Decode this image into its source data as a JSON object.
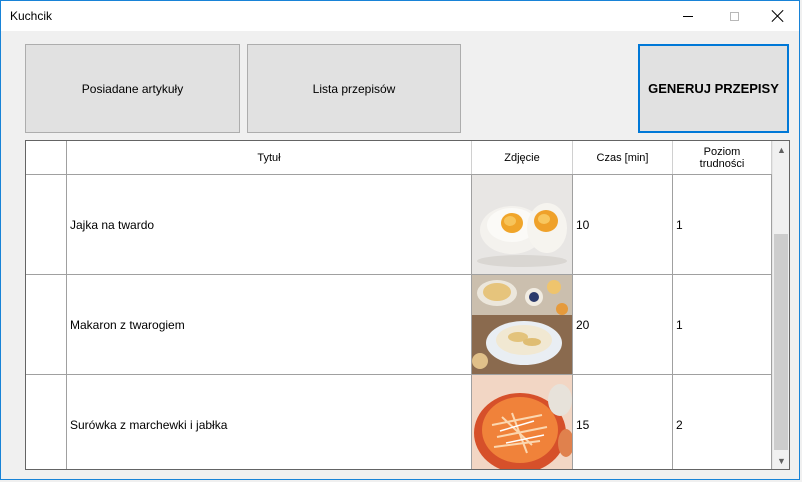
{
  "window": {
    "title": "Kuchcik"
  },
  "toolbar": {
    "owned_items_label": "Posiadane artykuły",
    "recipe_list_label": "Lista przepisów",
    "generate_label": "GENERUJ PRZEPISY"
  },
  "grid": {
    "columns": [
      "Tytuł",
      "Zdjęcie",
      "Czas [min]",
      "Poziom trudności"
    ],
    "rows": [
      {
        "title": "Jajka na twardo",
        "photo": "boiled-eggs-photo",
        "time": "10",
        "level": "1"
      },
      {
        "title": "Makaron z twarogiem",
        "photo": "pasta-with-cottage-cheese-photo",
        "time": "20",
        "level": "1"
      },
      {
        "title": "Surówka z marchewki i jabłka",
        "photo": "carrot-apple-salad-photo",
        "time": "15",
        "level": "2"
      }
    ]
  },
  "colors": {
    "accent": "#0078d7",
    "button_bg": "#e1e1e1",
    "window_bg": "#f0f0f0"
  }
}
